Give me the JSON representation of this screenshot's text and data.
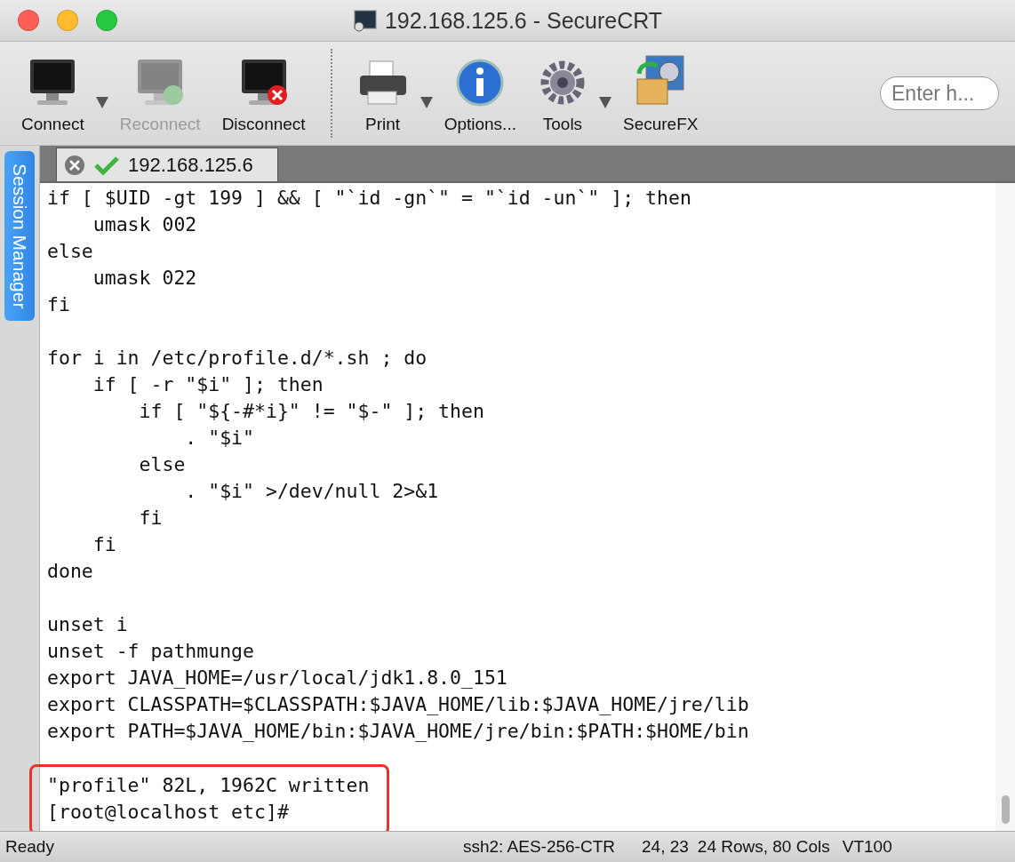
{
  "window": {
    "title": "192.168.125.6 - SecureCRT"
  },
  "toolbar": {
    "groups": [
      [
        {
          "label": "Connect",
          "disabled": false,
          "menu": true
        },
        {
          "label": "Reconnect",
          "disabled": true,
          "menu": false
        },
        {
          "label": "Disconnect",
          "disabled": false,
          "menu": false
        }
      ],
      [
        {
          "label": "Print",
          "disabled": false,
          "menu": true
        },
        {
          "label": "Options...",
          "disabled": false,
          "menu": false
        },
        {
          "label": "Tools",
          "disabled": false,
          "menu": true
        },
        {
          "label": "SecureFX",
          "disabled": false,
          "menu": false
        }
      ]
    ],
    "search": {
      "placeholder": "Enter h..."
    }
  },
  "sidebar": {
    "tab": "Session Manager"
  },
  "tabs": [
    {
      "label": "192.168.125.6",
      "selected": true,
      "connected": true
    }
  ],
  "terminal": {
    "blocks": [
      {
        "highlighted": false,
        "lines": [
          "if [ $UID -gt 199 ] && [ \"`id -gn`\" = \"`id -un`\" ]; then",
          "    umask 002",
          "else",
          "    umask 022",
          "fi"
        ]
      },
      {
        "highlighted": false,
        "lines": [
          "for i in /etc/profile.d/*.sh ; do",
          "    if [ -r \"$i\" ]; then",
          "        if [ \"${-#*i}\" != \"$-\" ]; then",
          "            . \"$i\"",
          "        else",
          "            . \"$i\" >/dev/null 2>&1",
          "        fi",
          "    fi",
          "done"
        ]
      },
      {
        "highlighted": false,
        "lines": [
          "unset i",
          "unset -f pathmunge",
          "export JAVA_HOME=/usr/local/jdk1.8.0_151",
          "export CLASSPATH=$CLASSPATH:$JAVA_HOME/lib:$JAVA_HOME/jre/lib",
          "export PATH=$JAVA_HOME/bin:$JAVA_HOME/jre/bin:$PATH:$HOME/bin"
        ]
      },
      {
        "highlighted": true,
        "lines": [
          "\"profile\" 82L, 1962C written",
          "[root@localhost etc]#"
        ]
      }
    ]
  },
  "status_bar": {
    "status": "Ready",
    "cipher": "ssh2: AES-256-CTR",
    "cursor": "24, 23",
    "size": "24 Rows, 80 Cols",
    "emulation": "VT100"
  }
}
